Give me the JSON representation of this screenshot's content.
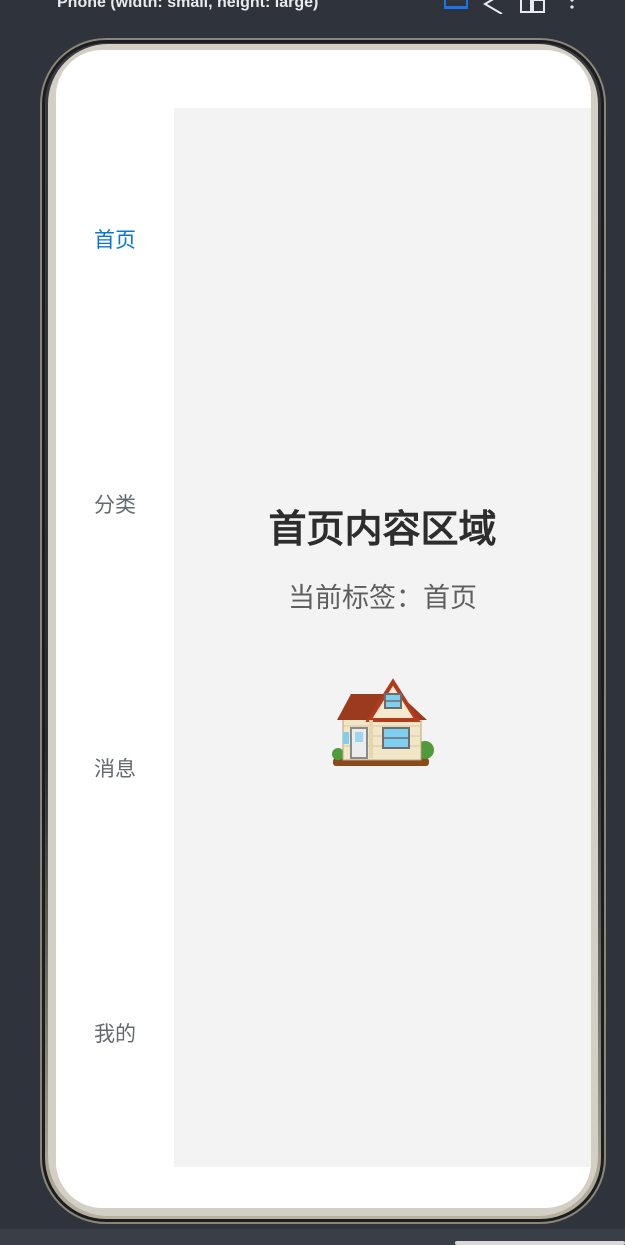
{
  "toolbar": {
    "title": "Phone (width: small, height: large)",
    "icons": [
      "screen-icon",
      "back-triangle-icon",
      "device-switch-icon",
      "more-vert-icon"
    ]
  },
  "sidebar": {
    "items": [
      {
        "label": "首页",
        "active": true
      },
      {
        "label": "分类",
        "active": false
      },
      {
        "label": "消息",
        "active": false
      },
      {
        "label": "我的",
        "active": false
      }
    ]
  },
  "content": {
    "title": "首页内容区域",
    "subtitle": "当前标签：首页",
    "emoji_icon": "house-icon"
  },
  "colors": {
    "active": "#0a74d8",
    "inactive": "#666a70",
    "content_bg": "#f3f3f3",
    "background": "#2f343c"
  }
}
